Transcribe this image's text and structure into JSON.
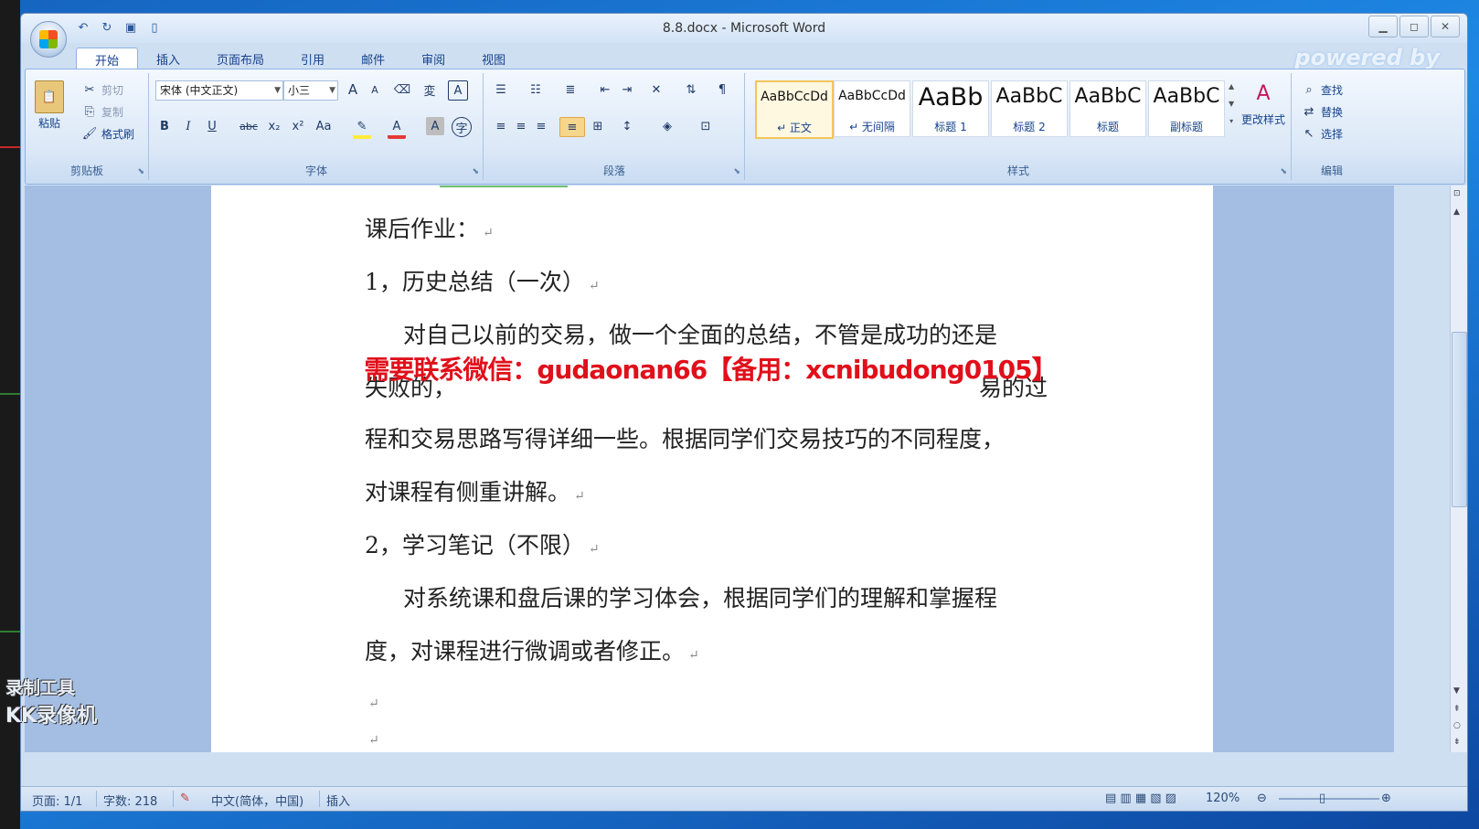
{
  "window": {
    "title": "8.8.docx - Microsoft Word",
    "powered": "powered by"
  },
  "tabs": [
    "开始",
    "插入",
    "页面布局",
    "引用",
    "邮件",
    "审阅",
    "视图"
  ],
  "clipboard": {
    "paste": "粘贴",
    "cut": "剪切",
    "copy": "复制",
    "format_painter": "格式刷",
    "label": "剪贴板"
  },
  "font": {
    "name": "宋体 (中文正文)",
    "size": "小三",
    "label": "字体",
    "bold": "B",
    "italic": "I",
    "underline": "U",
    "strike": "abc",
    "sub": "x₂",
    "sup": "x²",
    "case": "Aa",
    "grow": "A",
    "shrink": "A",
    "color_a": "A"
  },
  "paragraph": {
    "label": "段落"
  },
  "styles": {
    "label": "样式",
    "tiles": [
      {
        "sample": "AaBbCcDd",
        "name": "↵ 正文"
      },
      {
        "sample": "AaBbCcDd",
        "name": "↵ 无间隔"
      },
      {
        "sample": "AaBb",
        "name": "标题 1"
      },
      {
        "sample": "AaBbC",
        "name": "标题 2"
      },
      {
        "sample": "AaBbC",
        "name": "标题"
      },
      {
        "sample": "AaBbC",
        "name": "副标题"
      }
    ],
    "change": "更改样式"
  },
  "editing": {
    "label": "编辑",
    "find": "查找",
    "replace": "替换",
    "select": "选择"
  },
  "document": {
    "lines": [
      "课后作业：",
      "1，历史总结（一次）",
      "对自己以前的交易，做一个全面的总结，不管是成功的还是",
      "失败的，",
      "易的过",
      "程和交易思路写得详细一些。根据同学们交易技巧的不同程度，",
      "对课程有侧重讲解。",
      "2，学习笔记（不限）",
      "对系统课和盘后课的学习体会，根据同学们的理解和掌握程",
      "度，对课程进行微调或者修正。"
    ],
    "banner": "需要联系微信：gudaonan66【备用：xcnibudong0105】"
  },
  "status": {
    "page": "页面: 1/1",
    "words": "字数: 218",
    "lang": "中文(简体，中国)",
    "mode": "插入",
    "zoom": "120%"
  },
  "recorder": {
    "line1": "录制工具",
    "line2": "KK录像机"
  }
}
